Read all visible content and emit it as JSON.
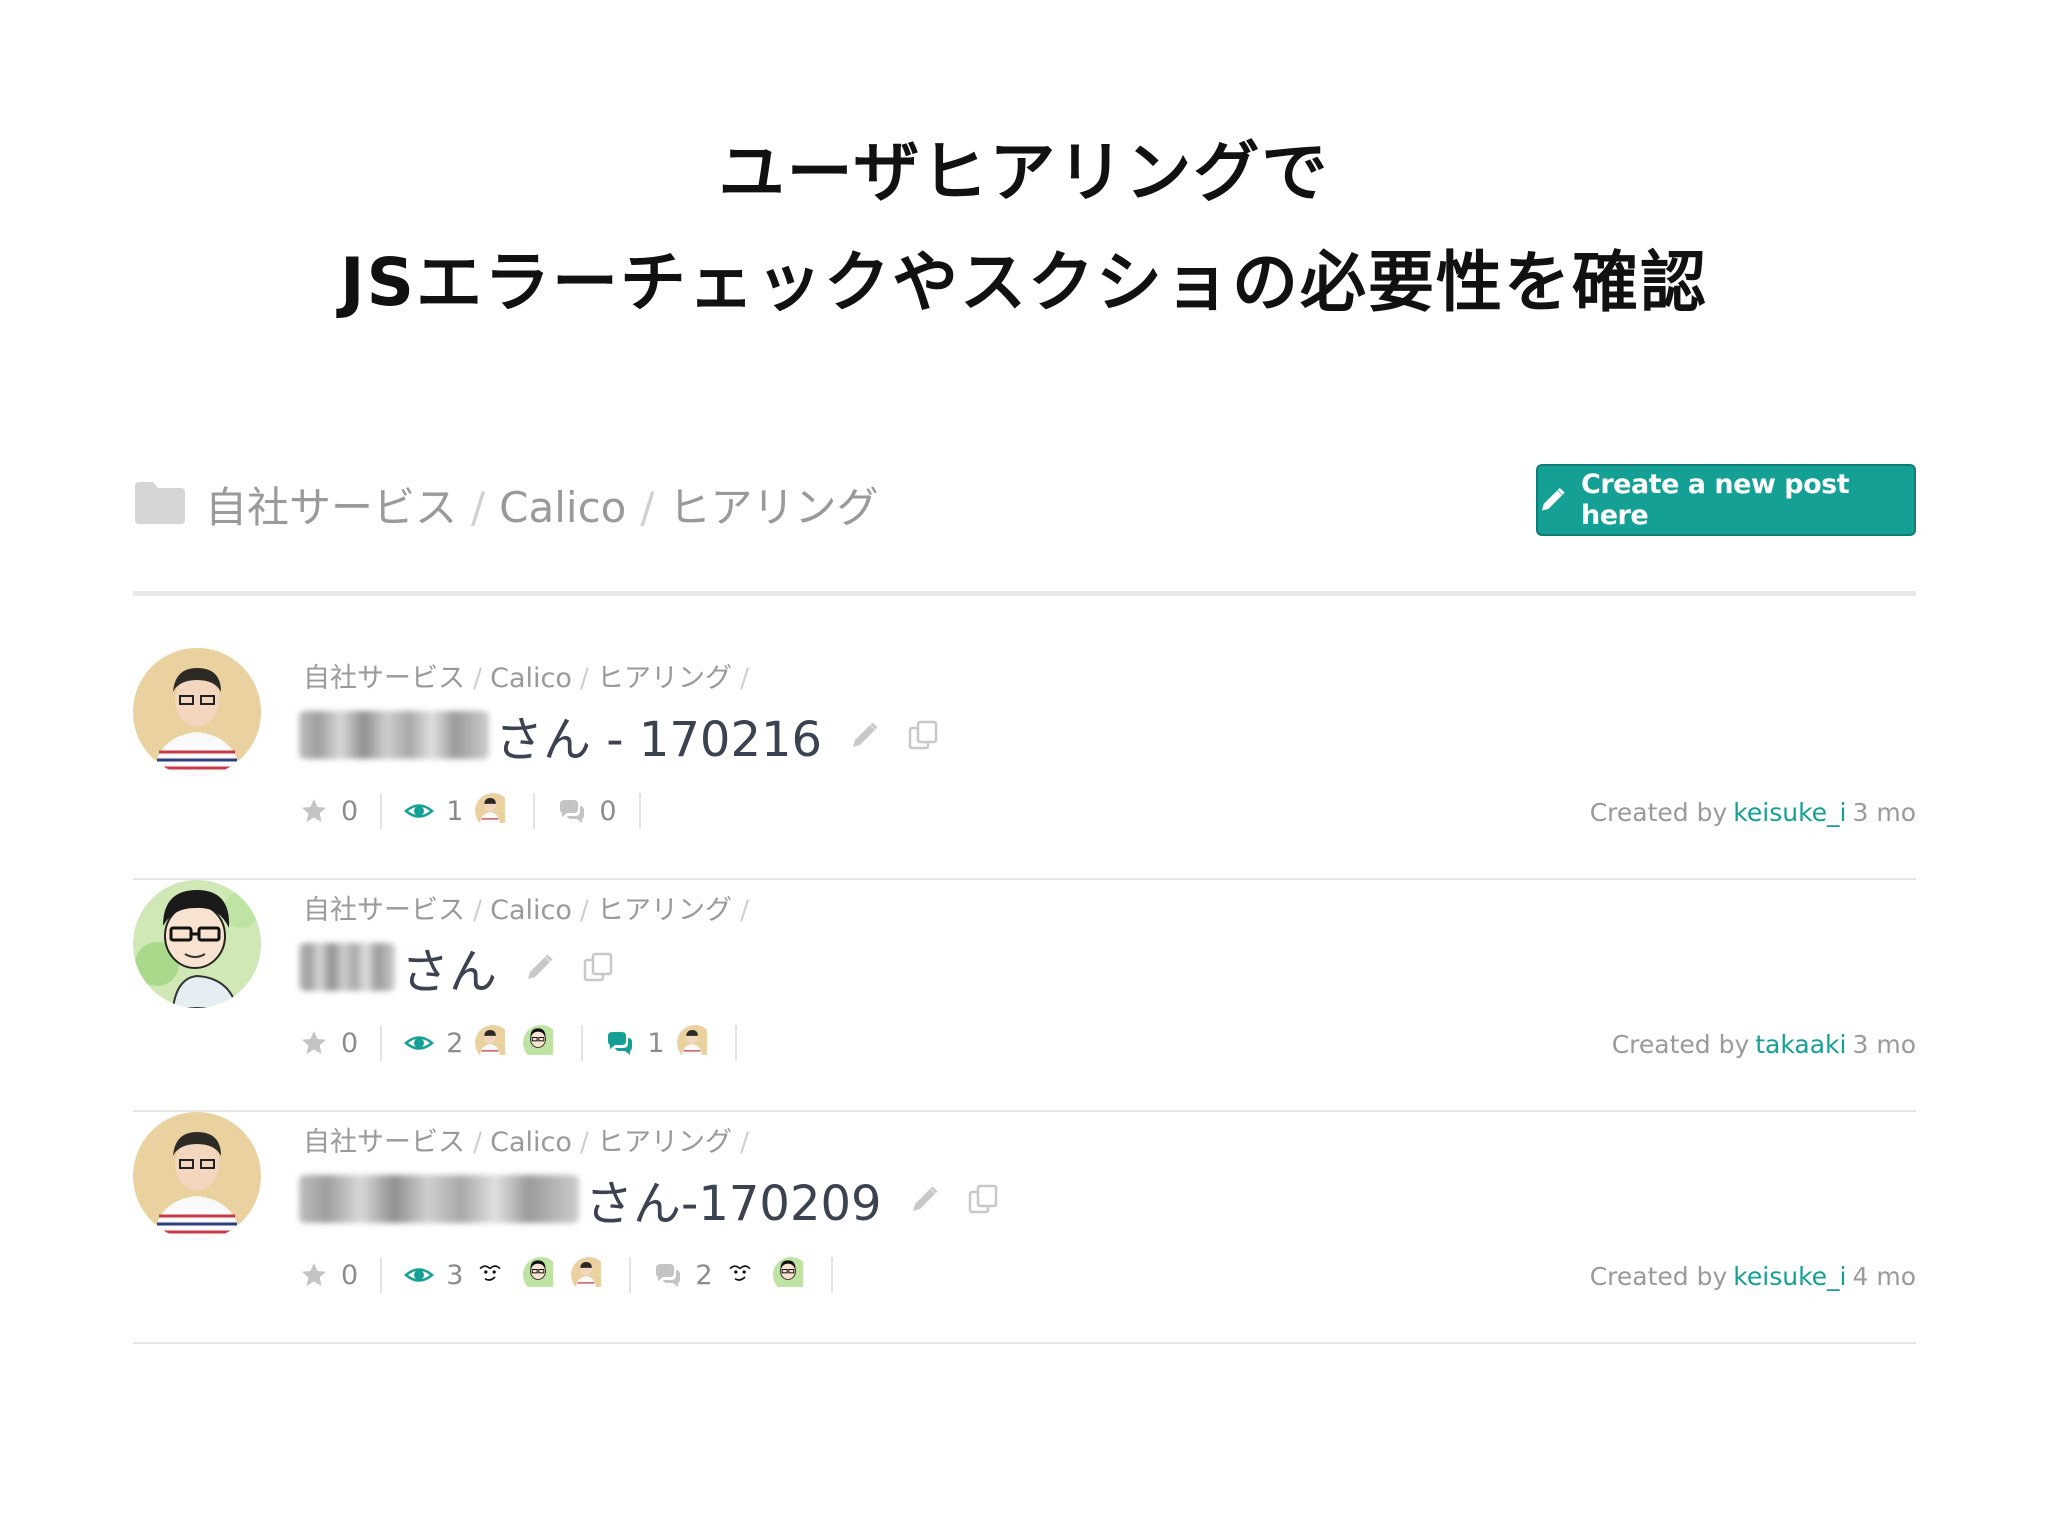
{
  "heading": {
    "line1": "ユーザヒアリングで",
    "line2": "JSエラーチェックやスクショの必要性を確認"
  },
  "breadcrumb": {
    "items": [
      "自社サービス",
      "Calico",
      "ヒアリング"
    ],
    "separator": "/"
  },
  "create_button": {
    "label": "Create a new post here"
  },
  "colors": {
    "accent": "#15a096",
    "text_muted": "#9a9a9a",
    "title": "#3b4250"
  },
  "posts": [
    {
      "crumb": [
        "自社サービス",
        "Calico",
        "ヒアリング",
        ""
      ],
      "title_suffix": "さん - 170216",
      "stars": "0",
      "watchers": "1",
      "comments": "0",
      "created_by_label": "Created by",
      "author": "keisuke_i",
      "age": "3 mo"
    },
    {
      "crumb": [
        "自社サービス",
        "Calico",
        "ヒアリング",
        ""
      ],
      "title_suffix": "さん",
      "stars": "0",
      "watchers": "2",
      "comments": "1",
      "created_by_label": "Created by",
      "author": "takaaki",
      "age": "3 mo"
    },
    {
      "crumb": [
        "自社サービス",
        "Calico",
        "ヒアリング",
        ""
      ],
      "title_suffix": "さん-170209",
      "stars": "0",
      "watchers": "3",
      "comments": "2",
      "created_by_label": "Created by",
      "author": "keisuke_i",
      "age": "4 mo"
    }
  ],
  "icons": [
    "folder-icon",
    "pencil-icon",
    "star-icon",
    "eye-icon",
    "comments-icon",
    "copy-icon"
  ]
}
